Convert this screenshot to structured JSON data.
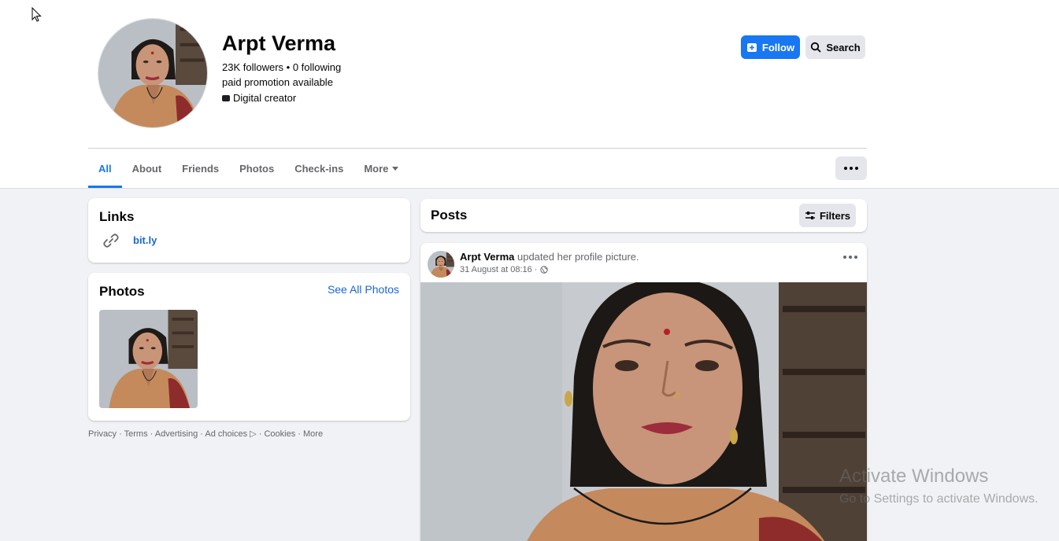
{
  "profile": {
    "name": "Arpt Verma",
    "stats": "23K followers • 0 following",
    "bio": "paid promotion available",
    "category": "Digital creator",
    "avatar_icon": "profile-photo"
  },
  "header_actions": {
    "follow_label": "Follow",
    "search_label": "Search"
  },
  "tabs": [
    {
      "label": "All"
    },
    {
      "label": "About"
    },
    {
      "label": "Friends"
    },
    {
      "label": "Photos"
    },
    {
      "label": "Check-ins"
    },
    {
      "label": "More"
    }
  ],
  "links_card": {
    "title": "Links",
    "link": "bit.ly"
  },
  "photos_card": {
    "title": "Photos",
    "see_all": "See All Photos"
  },
  "footer": {
    "privacy": "Privacy",
    "terms": "Terms",
    "advertising": "Advertising",
    "ad_choices": "Ad choices",
    "cookies": "Cookies",
    "more": "More"
  },
  "posts": {
    "title": "Posts",
    "filters_label": "Filters"
  },
  "post": {
    "author": "Arpt Verma",
    "action": " updated her profile picture.",
    "timestamp": "31 August at 08:16 ·"
  },
  "watermark": {
    "title": "Activate Windows",
    "subtitle": "Go to Settings to activate Windows."
  },
  "colors": {
    "accent": "#1877f2",
    "link": "#1b66d2",
    "background": "#f0f2f5"
  }
}
